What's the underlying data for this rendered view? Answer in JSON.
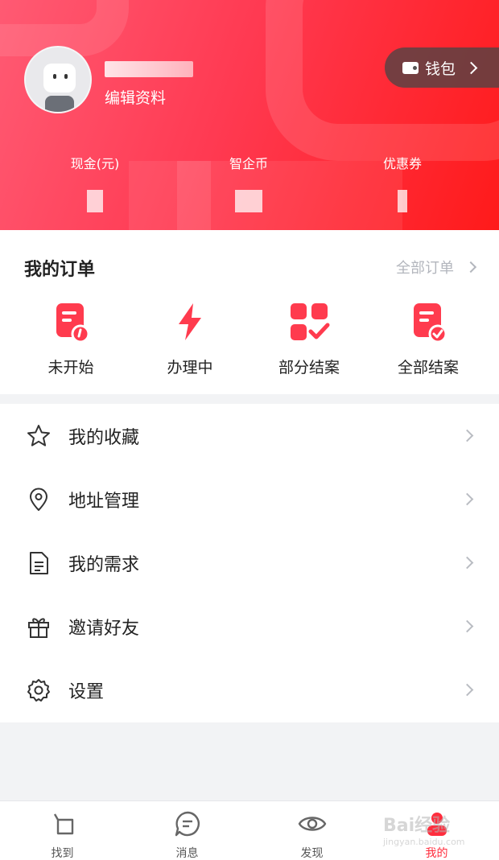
{
  "profile": {
    "edit_label": "编辑资料",
    "wallet_label": "钱包"
  },
  "stats": [
    {
      "label": "现金(元)"
    },
    {
      "label": "智企币"
    },
    {
      "label": "优惠券"
    }
  ],
  "orders": {
    "title": "我的订单",
    "all_label": "全部订单",
    "items": [
      {
        "label": "未开始",
        "icon": "order-pending-icon"
      },
      {
        "label": "办理中",
        "icon": "lightning-icon"
      },
      {
        "label": "部分结案",
        "icon": "partial-complete-icon"
      },
      {
        "label": "全部结案",
        "icon": "all-complete-icon"
      }
    ]
  },
  "menu": [
    {
      "label": "我的收藏",
      "icon": "star-icon"
    },
    {
      "label": "地址管理",
      "icon": "location-pin-icon"
    },
    {
      "label": "我的需求",
      "icon": "document-icon"
    },
    {
      "label": "邀请好友",
      "icon": "gift-icon"
    },
    {
      "label": "设置",
      "icon": "gear-icon"
    }
  ],
  "tabbar": [
    {
      "label": "找到",
      "icon": "find-icon"
    },
    {
      "label": "消息",
      "icon": "message-icon"
    },
    {
      "label": "发现",
      "icon": "eye-icon"
    },
    {
      "label": "我的",
      "icon": "profile-icon",
      "active": true
    }
  ],
  "colors": {
    "accent": "#ff2d3d",
    "header_start": "#ff5a73",
    "header_end": "#ff1a1a"
  },
  "watermark": {
    "brand": "Bai经验",
    "url": "jingyan.baidu.com"
  }
}
